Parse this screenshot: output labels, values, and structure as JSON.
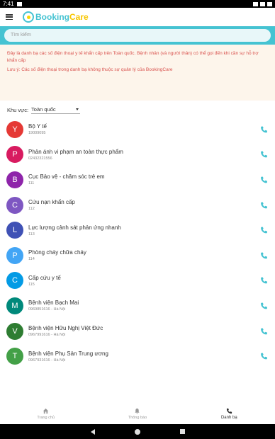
{
  "statusbar": {
    "time": "7:41"
  },
  "app": {
    "brand_part1": "Booking",
    "brand_part2": "Care"
  },
  "search": {
    "placeholder": "Tìm kiếm"
  },
  "notice": {
    "text": "Đây là danh bạ các số điện thoại y tế khẩn cấp trên Toàn quốc. Bệnh nhân (và người thân) có thể gọi đến khi cần sự hỗ trợ khẩn cấp",
    "note": "Lưu ý: Các số điện thoại trong danh bạ không thuộc sự quản lý của BookingCare"
  },
  "region": {
    "label": "Khu vực:",
    "value": "Toàn quốc"
  },
  "contacts": [
    {
      "letter": "Y",
      "color": "#e53935",
      "name": "Bộ Y tế",
      "sub": "19009095"
    },
    {
      "letter": "P",
      "color": "#d81b60",
      "name": "Phản ánh vi phạm an toàn thực phẩm",
      "sub": "02432321556"
    },
    {
      "letter": "B",
      "color": "#8e24aa",
      "name": "Cục Bảo vệ - chăm sóc trẻ em",
      "sub": "111"
    },
    {
      "letter": "C",
      "color": "#7e57c2",
      "name": "Cứu nạn khẩn cấp",
      "sub": "112"
    },
    {
      "letter": "L",
      "color": "#3f51b5",
      "name": "Lực lượng cảnh sát phản ứng nhanh",
      "sub": "113"
    },
    {
      "letter": "P",
      "color": "#42a5f5",
      "name": "Phòng cháy chữa cháy",
      "sub": "114"
    },
    {
      "letter": "C",
      "color": "#039be5",
      "name": "Cấp cứu y tế",
      "sub": "115"
    },
    {
      "letter": "M",
      "color": "#00897b",
      "name": "Bệnh viện Bạch Mai",
      "sub": "0969851616 - Hà Nội"
    },
    {
      "letter": "V",
      "color": "#2e7d32",
      "name": "Bệnh viện Hữu Nghị Việt Đức",
      "sub": "0967991616 - Hà Nội"
    },
    {
      "letter": "T",
      "color": "#43a047",
      "name": "Bệnh viện Phụ Sản Trung ương",
      "sub": "0967931616 - Hà Nội"
    }
  ],
  "nav": {
    "home": "Trang chủ",
    "notifications": "Thông báo",
    "directory": "Danh bạ"
  },
  "colors": {
    "accent": "#45c3d2",
    "brand_yellow": "#f7c600",
    "notice_text": "#d9534f",
    "phone_icon": "#45c3d2"
  }
}
